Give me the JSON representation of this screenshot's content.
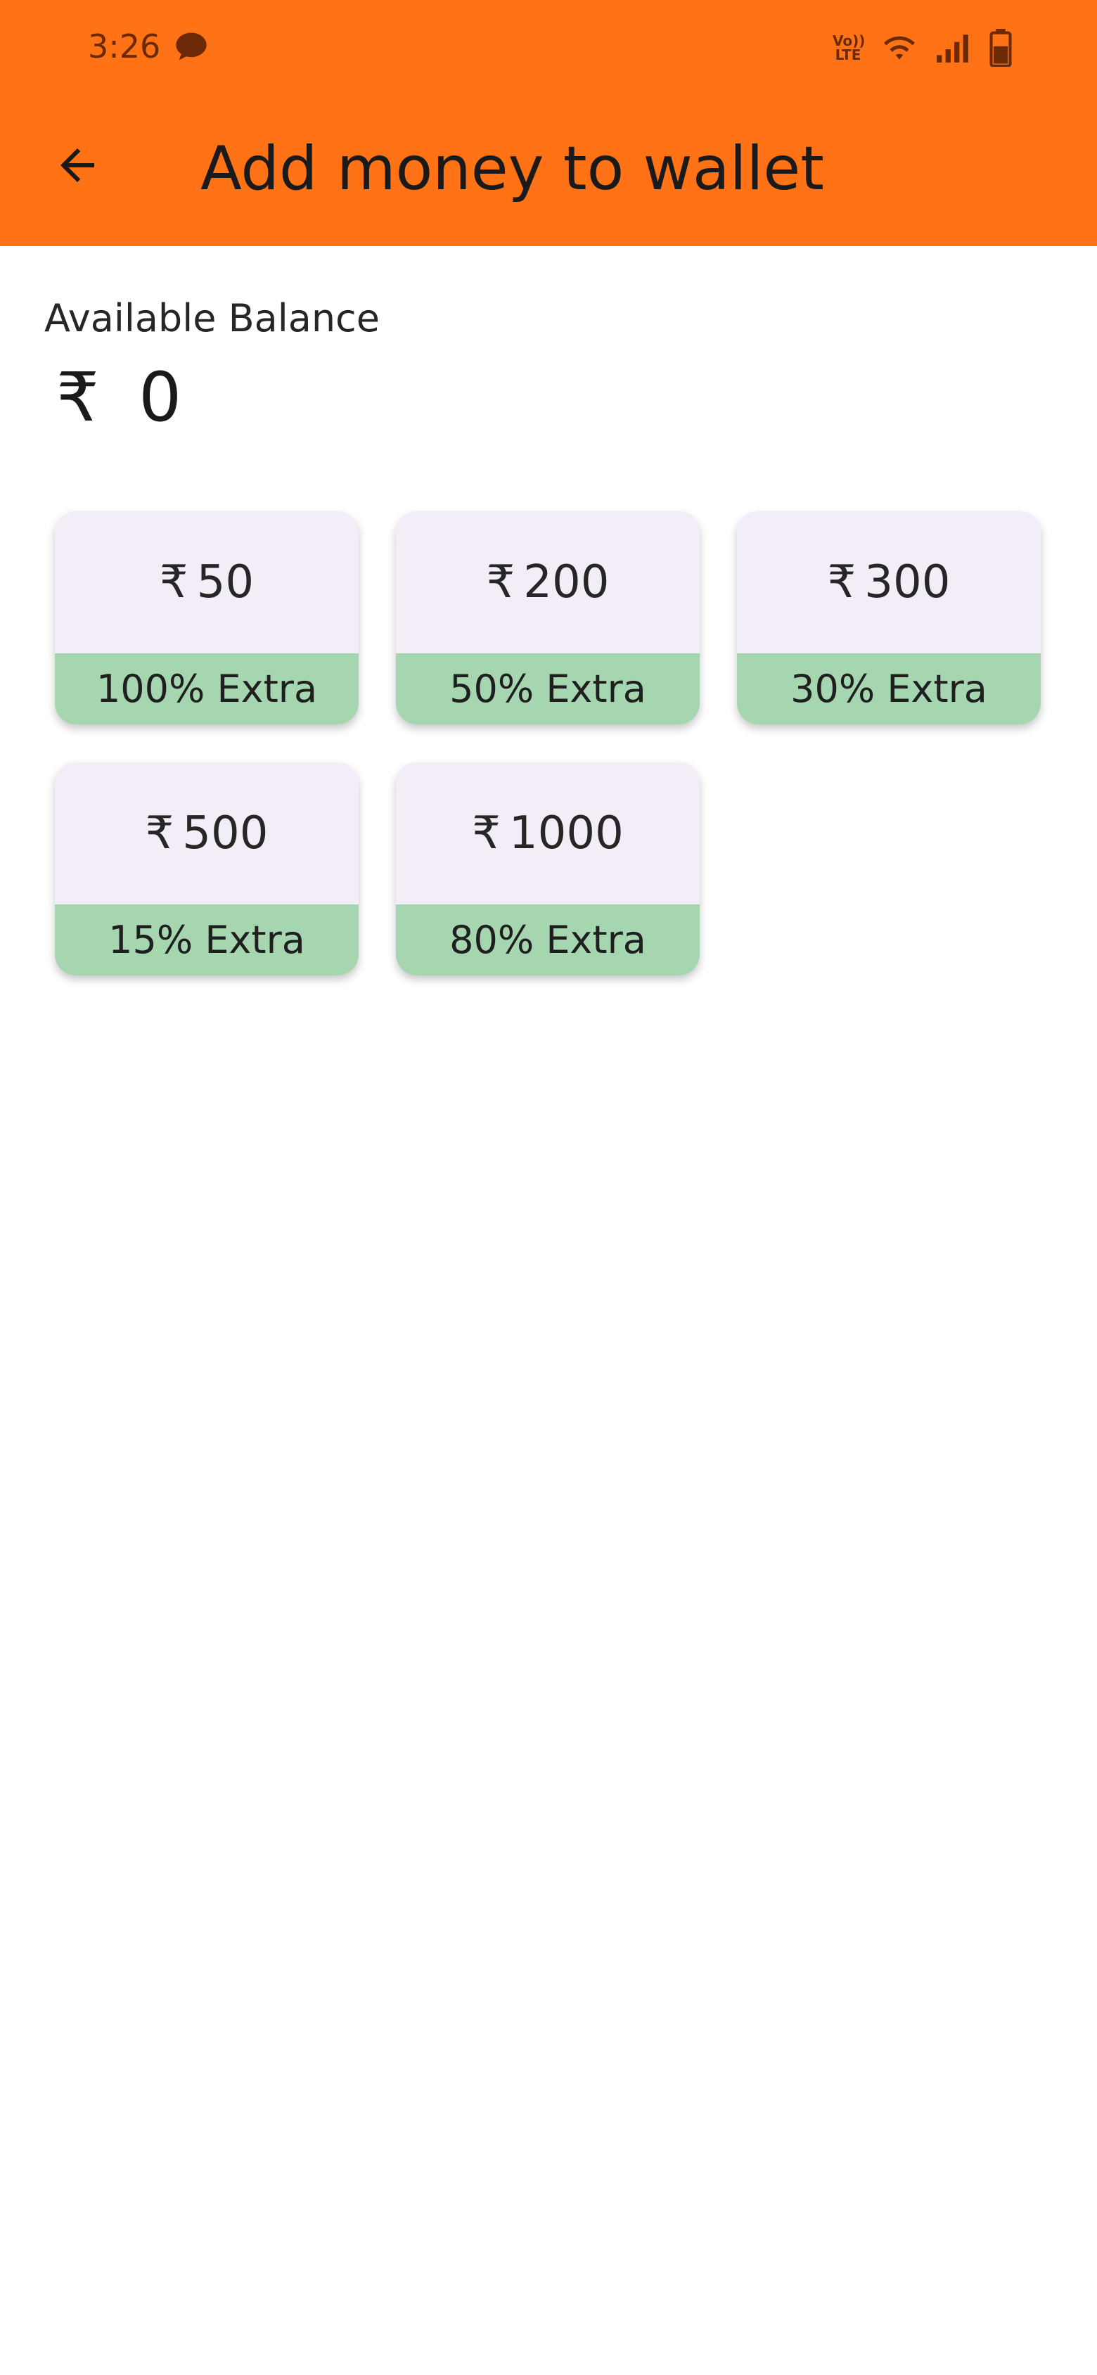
{
  "status_bar": {
    "time": "3:26",
    "volte_line1": "Vo))",
    "volte_line2": "LTE"
  },
  "header": {
    "title": "Add money to wallet"
  },
  "balance": {
    "label": "Available Balance",
    "currency": "₹",
    "amount": "0"
  },
  "offers": [
    {
      "currency": "₹",
      "amount": "50",
      "extra": "100% Extra"
    },
    {
      "currency": "₹",
      "amount": "200",
      "extra": "50% Extra"
    },
    {
      "currency": "₹",
      "amount": "300",
      "extra": "30% Extra"
    },
    {
      "currency": "₹",
      "amount": "500",
      "extra": "15% Extra"
    },
    {
      "currency": "₹",
      "amount": "1000",
      "extra": "80% Extra"
    }
  ],
  "colors": {
    "app_bar": "#ff7216",
    "card_top": "#f3edf7",
    "card_bottom": "#a5d6b0"
  }
}
